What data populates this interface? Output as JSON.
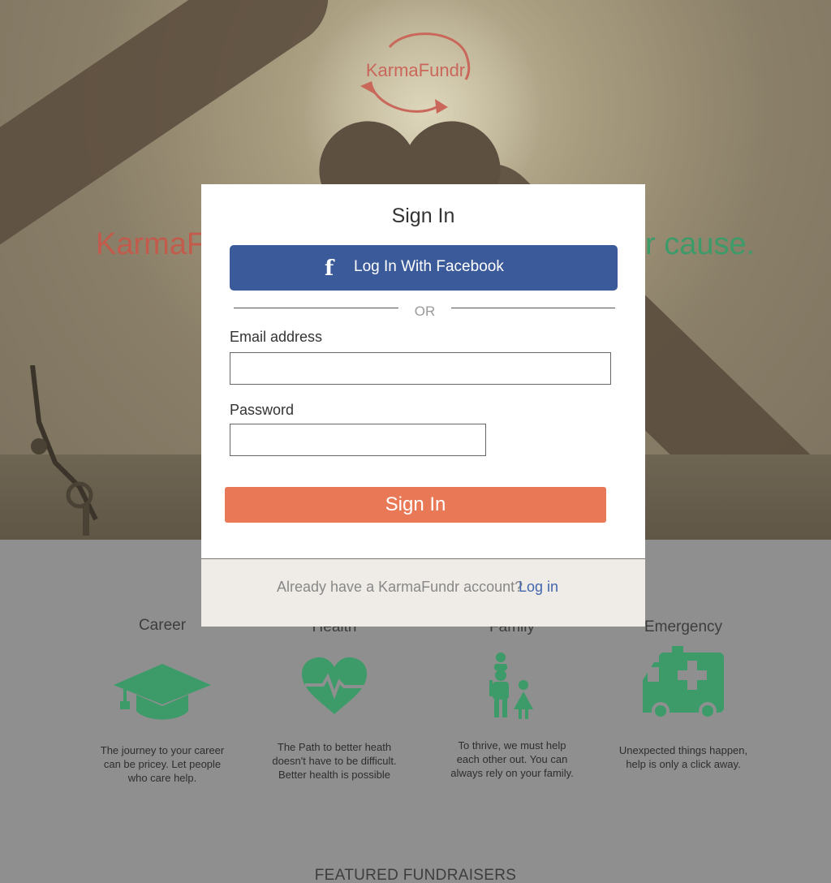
{
  "brand": {
    "logo_text": "KarmaFundr"
  },
  "hero": {
    "heading_left": "KarmaF",
    "heading_right": "r cause."
  },
  "categories": [
    {
      "title": "Career",
      "icon": "graduation-cap-icon",
      "desc": [
        "The journey to your career",
        "can be pricey. Let people",
        "who care help."
      ]
    },
    {
      "title": "Health",
      "icon": "heartbeat-icon",
      "desc": [
        "The Path to better heath",
        "doesn't have to be difficult.",
        "Better health is possible"
      ]
    },
    {
      "title": "Family",
      "icon": "family-icon",
      "desc": [
        "To thrive, we must help",
        "each other out. You can",
        "always rely on your family."
      ]
    },
    {
      "title": "Emergency",
      "icon": "ambulance-icon",
      "desc": [
        "Unexpected things happen,",
        "help is only a click away."
      ]
    }
  ],
  "featured_heading": "FEATURED FUNDRAISERS",
  "modal": {
    "title": "Sign In",
    "facebook_icon": "f",
    "facebook_label": "Log In With Facebook",
    "or_text": "OR",
    "email_label": "Email address",
    "email_value": "",
    "password_label": "Password",
    "password_value": "",
    "submit_label": "Sign In",
    "footer_text": "Already have a KarmaFundr account?",
    "footer_link": "Log in"
  },
  "colors": {
    "accent_green": "#3c9b69",
    "accent_red": "#c35b4d",
    "facebook_blue": "#3b5a9a",
    "signin_orange": "#e87856",
    "link_blue": "#4166ad"
  }
}
